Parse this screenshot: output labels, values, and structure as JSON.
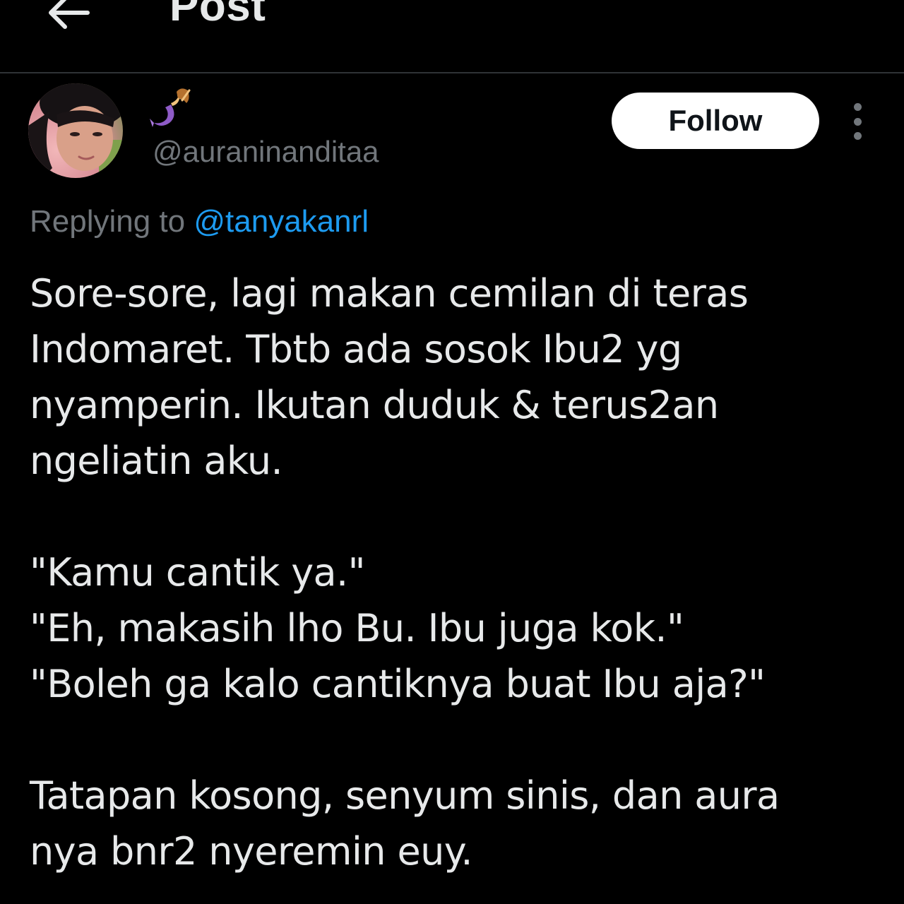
{
  "header": {
    "title": "Post",
    "back_icon": "arrow-left-icon"
  },
  "author": {
    "display_name_emoji": "mermaid-emoji",
    "handle": "@auraninanditaa",
    "follow_label": "Follow",
    "more_icon": "more-vertical-icon"
  },
  "reply": {
    "prefix": "Replying to",
    "mention": "@tanyakanrl"
  },
  "tweet": {
    "lines": [
      "Sore-sore, lagi makan cemilan di teras",
      "Indomaret. Tbtb ada sosok Ibu2 yg",
      "nyamperin. Ikutan duduk & terus2an",
      "ngeliatin aku.",
      "",
      "\"Kamu cantik ya.\"",
      "\"Eh, makasih lho Bu. Ibu juga kok.\"",
      "\"Boleh ga kalo cantiknya buat Ibu aja?\"",
      "",
      "Tatapan kosong, senyum sinis, dan aura",
      "nya bnr2 nyeremin euy."
    ]
  },
  "colors": {
    "background": "#000000",
    "text_primary": "#e7e9ea",
    "text_secondary": "#71767b",
    "link": "#1d9bf0",
    "divider": "#2f3336",
    "follow_bg": "#ffffff",
    "follow_text": "#0f1419"
  }
}
